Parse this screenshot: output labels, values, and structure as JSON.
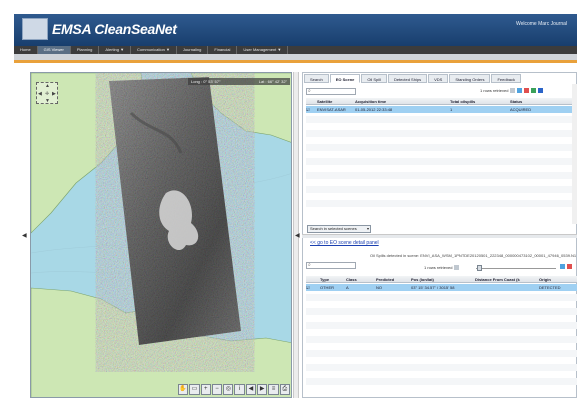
{
  "app": {
    "logo_text": "EMSA CleanSeaNet",
    "welcome": "Welcome Marc Journal"
  },
  "nav": {
    "items": [
      {
        "label": "Home"
      },
      {
        "label": "GIS Viewer"
      },
      {
        "label": "Planning"
      },
      {
        "label": "Alerting ▼"
      },
      {
        "label": "Communication ▼"
      },
      {
        "label": "Journaling"
      },
      {
        "label": "Financial"
      },
      {
        "label": "User Management ▼"
      }
    ],
    "active_index": 1
  },
  "map": {
    "long_readout": "Long : 0° 53' 57\"",
    "lat_readout": "Lat : 66° 42' 32\"",
    "land_color": "#cde7b4",
    "sea_color": "#a8d8e6",
    "toolbar_icons": [
      "pan-hand-icon",
      "zoom-box-icon",
      "zoom-in-icon",
      "zoom-out-icon",
      "full-extent-icon",
      "identify-icon",
      "previous-view-icon",
      "next-view-icon",
      "measure-icon",
      "print-icon"
    ]
  },
  "tabs": {
    "items": [
      {
        "label": "Search"
      },
      {
        "label": "EO Scene"
      },
      {
        "label": "Oil Spill"
      },
      {
        "label": "Detected Ships"
      },
      {
        "label": "VDS"
      },
      {
        "label": "Standing Orders"
      },
      {
        "label": "Feedback"
      }
    ],
    "active_index": 1
  },
  "scenes": {
    "rows_info": "1 rows retrieved",
    "columns": [
      "",
      "Satellite",
      "Acquisition time",
      "Total oilspills",
      "Status"
    ],
    "rows": [
      {
        "sel": "☑",
        "satellite": "ENVISAT-ASAR",
        "time": "01-05-2012 22:33:48",
        "spills": "1",
        "status": "ACQUIRED"
      }
    ]
  },
  "search_scenes_label": "Search in selected scenes",
  "detail": {
    "link": "<< go to EO scene detail panel",
    "oil_info": "Oil Spills detected in scene: ENVI_ASA_WSM_1PNTDE20120501_222348_000000473102_00001_47946_0539.N1",
    "rows_info": "1 rows retrieved",
    "columns": [
      "",
      "Type",
      "Class",
      "Predicted",
      "Pos (lon/lat)",
      "Distance From Coast (k",
      "Origin"
    ],
    "rows": [
      {
        "sel": "☑",
        "type": "OTHER",
        "class": "A",
        "predicted": "NO",
        "pos": "03° 15' 34.57\" / 3015' 58",
        "distance": "",
        "origin": "DETECTED"
      }
    ]
  },
  "colors": {
    "header_blue": "#183e6d",
    "accent_orange": "#e9a13b",
    "row_selected": "#9fd0f2"
  }
}
